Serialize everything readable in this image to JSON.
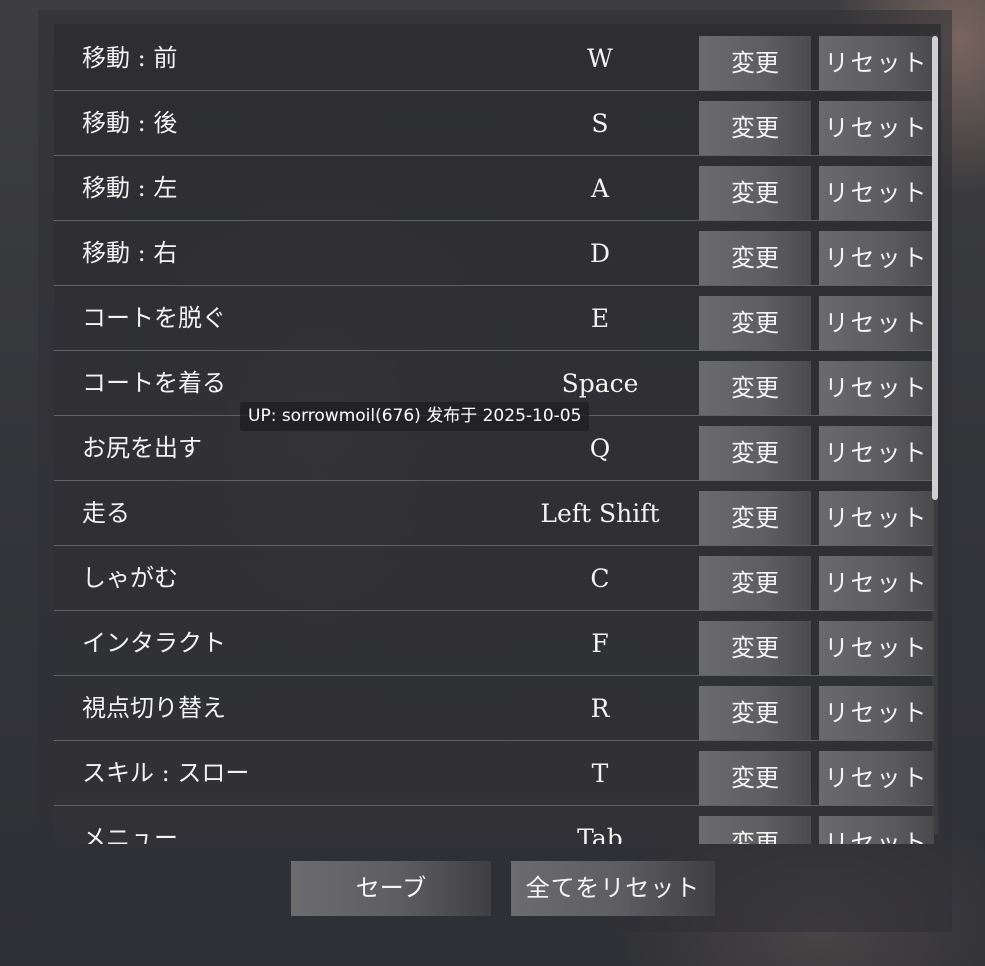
{
  "keybindings": [
    {
      "action": "移動 : 前",
      "key": "W"
    },
    {
      "action": "移動 : 後",
      "key": "S"
    },
    {
      "action": "移動 : 左",
      "key": "A"
    },
    {
      "action": "移動 : 右",
      "key": "D"
    },
    {
      "action": "コートを脱ぐ",
      "key": "E"
    },
    {
      "action": "コートを着る",
      "key": "Space"
    },
    {
      "action": "お尻を出す",
      "key": "Q"
    },
    {
      "action": "走る",
      "key": "Left Shift"
    },
    {
      "action": "しゃがむ",
      "key": "C"
    },
    {
      "action": "インタラクト",
      "key": "F"
    },
    {
      "action": "視点切り替え",
      "key": "R"
    },
    {
      "action": "スキル : スロー",
      "key": "T"
    },
    {
      "action": "メニュー",
      "key": "Tab"
    }
  ],
  "buttons": {
    "change_label": "変更",
    "reset_label": "リセット"
  },
  "footer": {
    "save_label": "セーブ",
    "reset_all_label": "全てをリセット"
  },
  "watermark": "UP: sorrowmoil(676) 发布于 2025-10-05"
}
